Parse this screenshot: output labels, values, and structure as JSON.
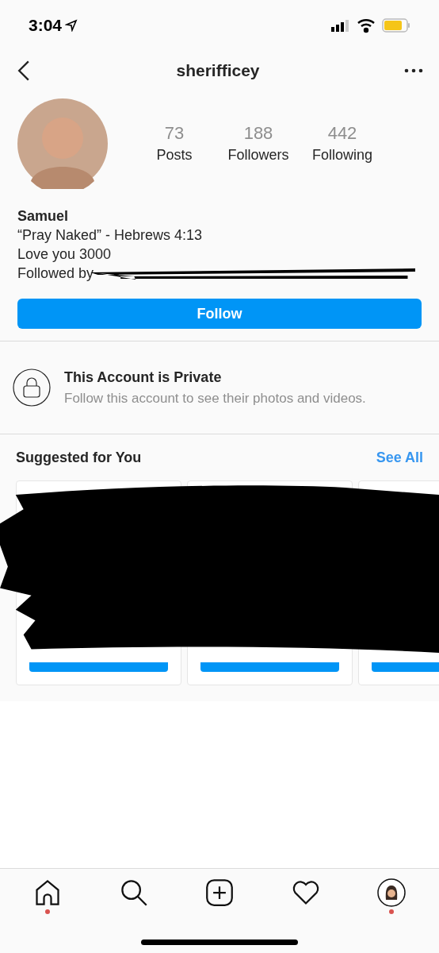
{
  "status_bar": {
    "time": "3:04"
  },
  "header": {
    "username": "sherifficey"
  },
  "stats": [
    {
      "value": "73",
      "label": "Posts"
    },
    {
      "value": "188",
      "label": "Followers"
    },
    {
      "value": "442",
      "label": "Following"
    }
  ],
  "bio": {
    "name": "Samuel",
    "lines": [
      "“Pray Naked” - Hebrews 4:13",
      "Love you 3000"
    ],
    "followed_by": "Followed by"
  },
  "follow_button": {
    "label": "Follow"
  },
  "private_notice": {
    "title": "This Account is Private",
    "text": "Follow this account to see their photos and videos."
  },
  "suggested": {
    "title": "Suggested for You",
    "link": "See All",
    "cards": [
      {
        "kind": "card"
      },
      {
        "kind": "card"
      },
      {
        "kind": "card"
      }
    ]
  },
  "tab_bar": [
    {
      "kind": "home",
      "notification": true
    },
    {
      "kind": "search",
      "notification": false
    },
    {
      "kind": "add",
      "notification": false
    },
    {
      "kind": "heart",
      "notification": false
    },
    {
      "kind": "profile",
      "notification": true
    }
  ]
}
